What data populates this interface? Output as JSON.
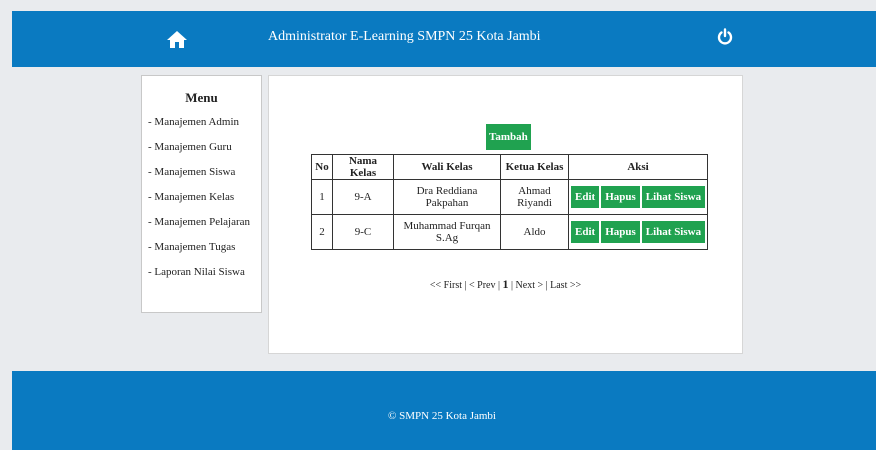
{
  "header": {
    "title": "Administrator E-Learning SMPN 25 Kota Jambi",
    "home_icon": "home-icon",
    "power_icon": "power-icon"
  },
  "sidebar": {
    "title": "Menu",
    "items": [
      {
        "label": "- Manajemen Admin"
      },
      {
        "label": "- Manajemen Guru"
      },
      {
        "label": "- Manajemen Siswa"
      },
      {
        "label": "- Manajemen Kelas"
      },
      {
        "label": "- Manajemen Pelajaran"
      },
      {
        "label": "- Manajemen Tugas"
      },
      {
        "label": "- Laporan Nilai Siswa"
      }
    ]
  },
  "main": {
    "add_button": "Tambah",
    "table": {
      "headers": [
        "No",
        "Nama Kelas",
        "Wali Kelas",
        "Ketua Kelas",
        "Aksi"
      ],
      "rows": [
        {
          "no": "1",
          "nama_kelas": "9-A",
          "wali_kelas": "Dra Reddiana Pakpahan",
          "ketua_kelas": "Ahmad Riyandi"
        },
        {
          "no": "2",
          "nama_kelas": "9-C",
          "wali_kelas": "Muhammad Furqan S.Ag",
          "ketua_kelas": "Aldo"
        }
      ],
      "actions": {
        "edit": "Edit",
        "hapus": "Hapus",
        "lihat": "Lihat Siswa"
      }
    },
    "pagination": {
      "first": "<< First",
      "prev": "< Prev",
      "current": "1",
      "next": "Next >",
      "last": "Last >>",
      "sep": " | "
    }
  },
  "footer": {
    "text": "© SMPN 25 Kota Jambi"
  },
  "colors": {
    "header_bg": "#0a7ac1",
    "button_green": "#20a250",
    "page_bg": "#e9ebee"
  }
}
